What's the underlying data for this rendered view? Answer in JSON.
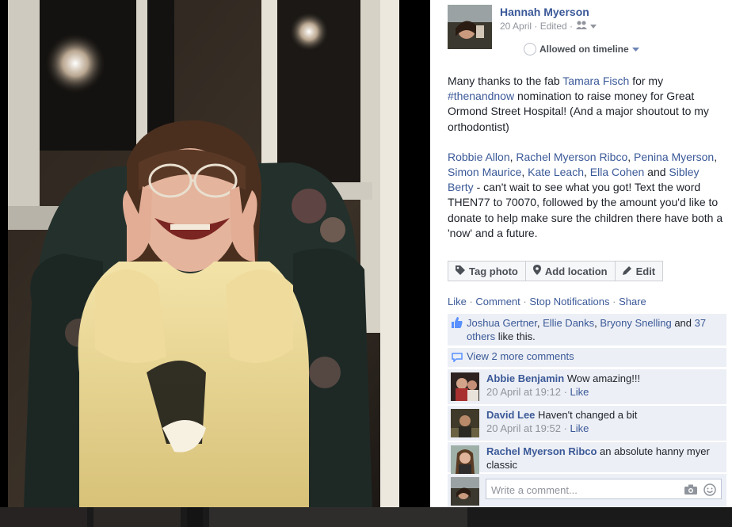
{
  "post": {
    "author": "Hannah Myerson",
    "date_meta": "20 April · Edited ·",
    "timeline_label": "Allowed on timeline",
    "caption": {
      "p1_pre": "Many thanks to the fab ",
      "p1_link1": "Tamara Fisch",
      "p1_mid": " for my ",
      "p1_link2": "#thenandnow",
      "p1_post": " nomination to raise money for Great Ormond Street Hospital! (And a major shoutout to my orthodontist)",
      "tags": [
        "Robbie Allon",
        "Rachel Myerson Ribco",
        "Penina Myerson",
        "Simon Maurice",
        "Kate Leach",
        "Ella Cohen",
        "Sibley Berty"
      ],
      "p2_post": " - can't wait to see what you got! Text the word THEN77 to 70070, followed by the amount you'd like to donate to help make sure the children there have both a 'now' and a future."
    }
  },
  "actions": {
    "tag_photo": "Tag photo",
    "add_location": "Add location",
    "edit": "Edit"
  },
  "ufi": {
    "like": "Like",
    "comment": "Comment",
    "stop_notifications": "Stop Notifications",
    "share": "Share",
    "sep": " · ",
    "likers": [
      "Joshua Gertner",
      "Ellie Danks",
      "Bryony Snelling"
    ],
    "likes_and": " and ",
    "likes_others": "37 others",
    "likes_tail": " like this.",
    "view_more": "View 2 more comments"
  },
  "comments": [
    {
      "author": "Abbie Benjamin",
      "text": " Wow amazing!!!",
      "time": "20 April at 19:12",
      "like": "Like"
    },
    {
      "author": "David Lee",
      "text": " Haven't changed a bit",
      "time": "20 April at 19:52",
      "like": "Like"
    },
    {
      "author": "Rachel Myerson Ribco",
      "text": " an absolute hanny myer classic"
    }
  ],
  "composer": {
    "placeholder": "Write a comment..."
  },
  "colors": {
    "link": "#3b5998",
    "ufi_bg": "#eceff5",
    "muted": "#90949c"
  },
  "icons": [
    "friends-icon",
    "chevron-down-icon",
    "tag-icon",
    "location-pin-icon",
    "pencil-icon",
    "thumbs-up-icon",
    "comment-bubble-icon",
    "camera-icon",
    "smiley-icon"
  ]
}
